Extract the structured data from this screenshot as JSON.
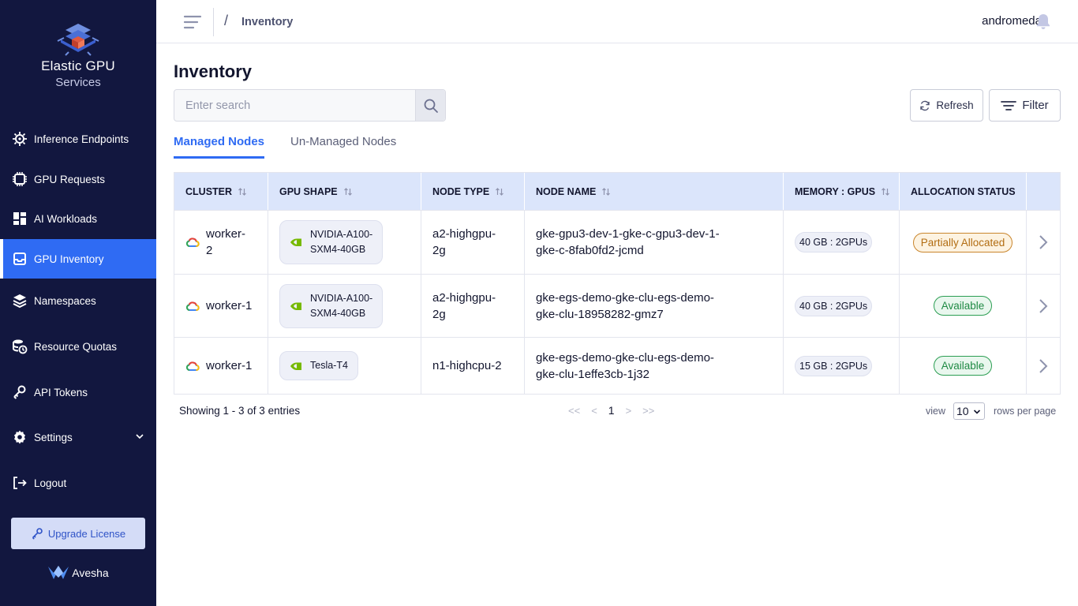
{
  "brand": {
    "title": "Elastic GPU",
    "subtitle": "Services"
  },
  "sidebar": {
    "items": [
      {
        "label": "Inference Endpoints",
        "icon": "chip-gear-icon"
      },
      {
        "label": "GPU Requests",
        "icon": "gpu-chip-icon"
      },
      {
        "label": "AI Workloads",
        "icon": "dashboard-icon"
      },
      {
        "label": "GPU Inventory",
        "icon": "inventory-icon",
        "active": true
      },
      {
        "label": "Namespaces",
        "icon": "layers-icon"
      },
      {
        "label": "Resource Quotas",
        "icon": "database-clock-icon"
      },
      {
        "label": "API Tokens",
        "icon": "key-icon"
      },
      {
        "label": "Settings",
        "icon": "gear-icon"
      },
      {
        "label": "Logout",
        "icon": "logout-icon"
      }
    ],
    "upgrade_label": "Upgrade License",
    "footer_brand": "Avesha"
  },
  "header": {
    "breadcrumb_sep": "/",
    "breadcrumb": "Inventory",
    "username": "andromeda"
  },
  "main": {
    "title": "Inventory",
    "search_placeholder": "Enter search",
    "refresh_label": "Refresh",
    "filter_label": "Filter",
    "tabs": [
      {
        "label": "Managed Nodes",
        "active": true
      },
      {
        "label": "Un-Managed Nodes",
        "active": false
      }
    ]
  },
  "table": {
    "headers": [
      "CLUSTER",
      "GPU SHAPE",
      "NODE TYPE",
      "NODE NAME",
      "MEMORY : GPUS",
      "ALLOCATION STATUS"
    ],
    "rows": [
      {
        "cluster_l1": "worker-",
        "cluster_l2": "2",
        "gpu_l1": "NVIDIA-A100-",
        "gpu_l2": "SXM4-40GB",
        "type_l1": "a2-highgpu-",
        "type_l2": "2g",
        "name_l1": "gke-gpu3-dev-1-gke-c-gpu3-dev-1-",
        "name_l2": "gke-c-8fab0fd2-jcmd",
        "memory": "40 GB : 2GPUs",
        "status": "Partially Allocated"
      },
      {
        "cluster_l1": "worker-1",
        "cluster_l2": "",
        "gpu_l1": "NVIDIA-A100-",
        "gpu_l2": "SXM4-40GB",
        "type_l1": "a2-highgpu-",
        "type_l2": "2g",
        "name_l1": "gke-egs-demo-gke-clu-egs-demo-",
        "name_l2": "gke-clu-18958282-gmz7",
        "memory": "40 GB : 2GPUs",
        "status": "Available"
      },
      {
        "cluster_l1": "worker-1",
        "cluster_l2": "",
        "gpu_l1": "Tesla-T4",
        "gpu_l2": "",
        "type_l1": "n1-highcpu-2",
        "type_l2": "",
        "name_l1": "gke-egs-demo-gke-clu-egs-demo-",
        "name_l2": "gke-clu-1effe3cb-1j32",
        "memory": "15 GB : 2GPUs",
        "status": "Available"
      }
    ]
  },
  "pagination": {
    "showing": "Showing 1 - 3 of 3 entries",
    "first": "<<",
    "prev": "<",
    "current": "1",
    "next": ">",
    "last": ">>",
    "view_label": "view",
    "rows_per_page": "10",
    "rows_label": "rows per page"
  },
  "colors": {
    "sidebar_bg": "#12173f",
    "accent": "#2f6bf3",
    "header_bg": "#dbe5fb",
    "partial": "#c9852c",
    "available": "#2c9e53"
  }
}
